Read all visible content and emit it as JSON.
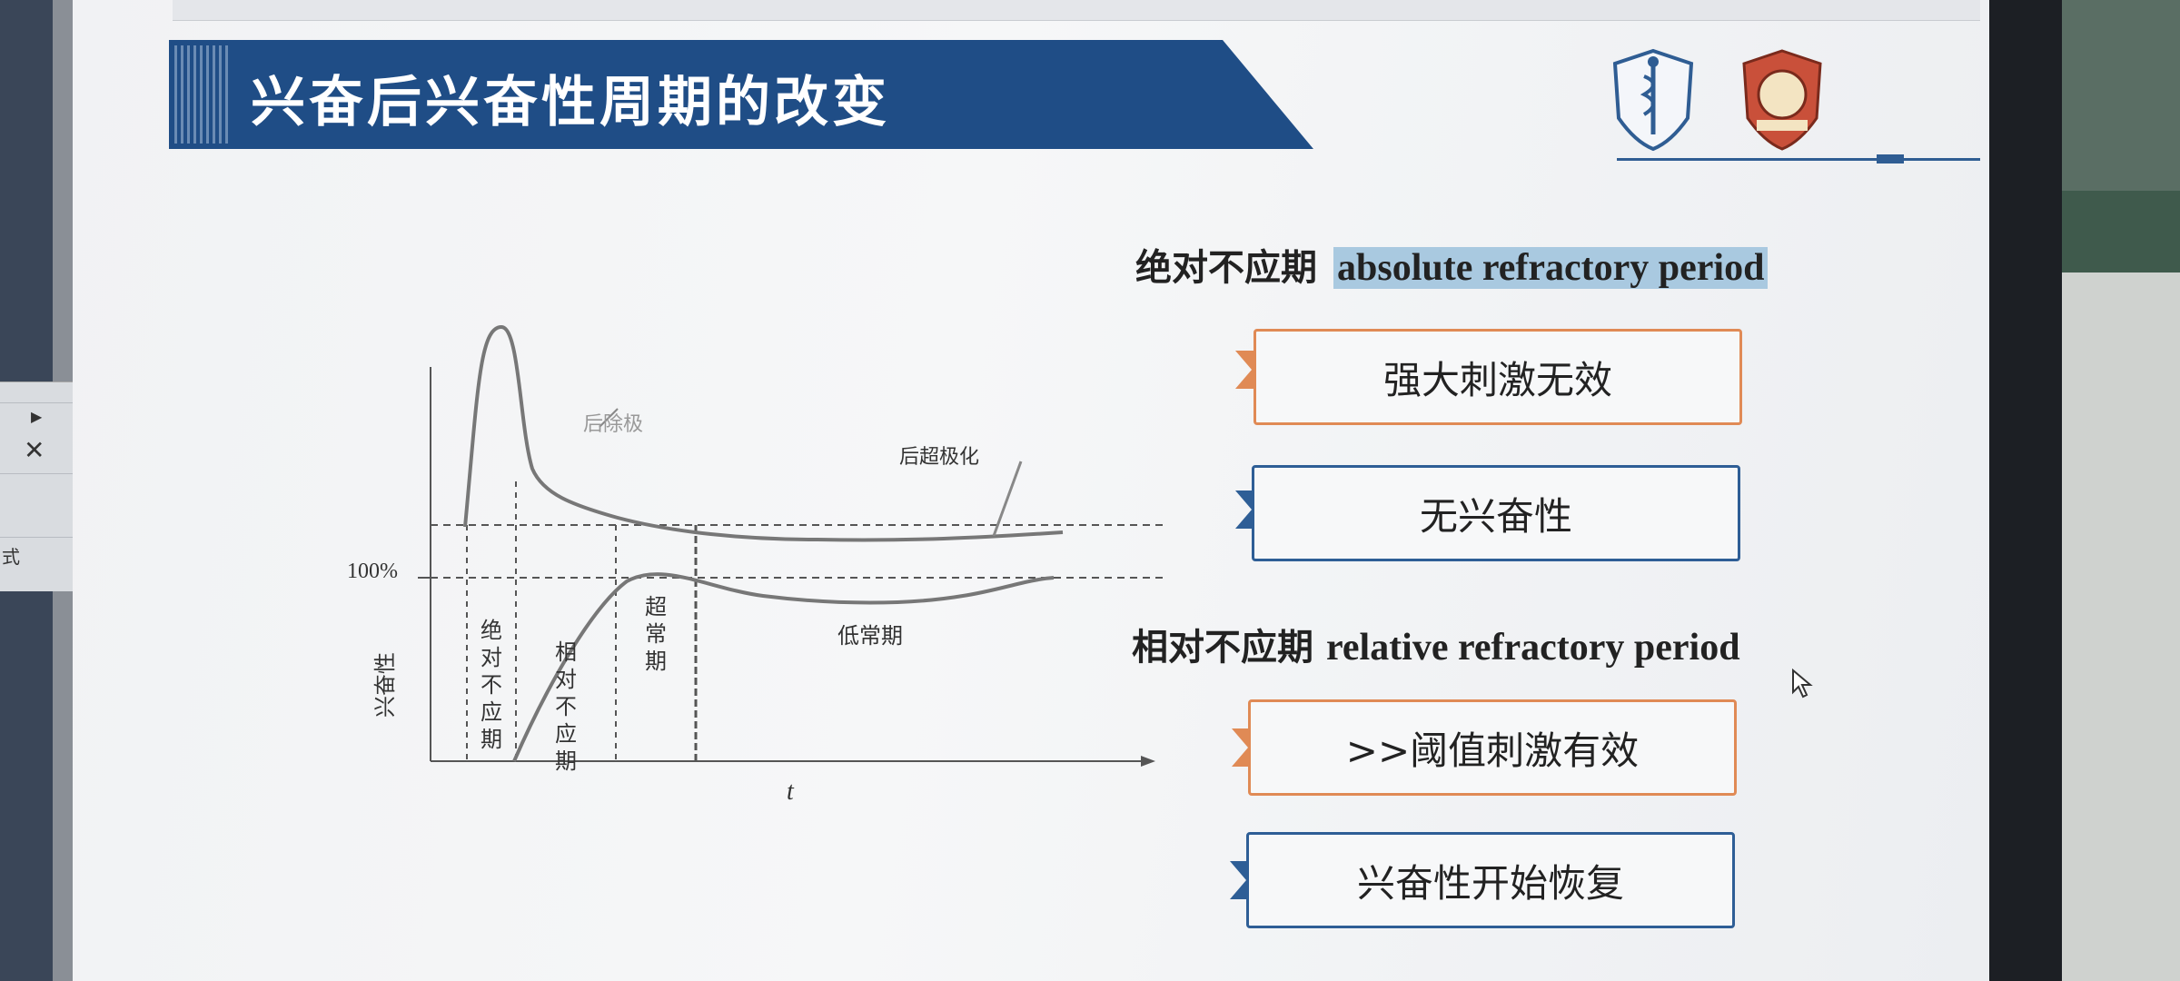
{
  "slide": {
    "title": "兴奋后兴奋性周期的改变",
    "absolute": {
      "label_cn": "绝对不应期",
      "label_en": "absolute  refractory  period",
      "items": [
        "强大刺激无效",
        "无兴奋性"
      ]
    },
    "relative": {
      "label_cn": "相对不应期",
      "label_en": "relative refractory period",
      "items": [
        ">>阈值刺激有效",
        "兴奋性开始恢复"
      ]
    }
  },
  "chart": {
    "y_label": "兴奋性",
    "y_tick": "100%",
    "x_label": "t",
    "curve_labels": {
      "after_depolarization": "后除极",
      "after_hyperpolarization": "后超极化"
    },
    "phases": [
      "绝对不应期",
      "相对不应期",
      "超常期",
      "低常期"
    ]
  },
  "side_panel": {
    "text": "式"
  },
  "colors": {
    "banner": "#1f4d86",
    "orange": "#e08a55",
    "blue": "#2e5e96",
    "highlight": "#a9c9e0"
  },
  "icons": [
    "close-icon",
    "chevron-double-right-icon",
    "school-logo-icon"
  ]
}
